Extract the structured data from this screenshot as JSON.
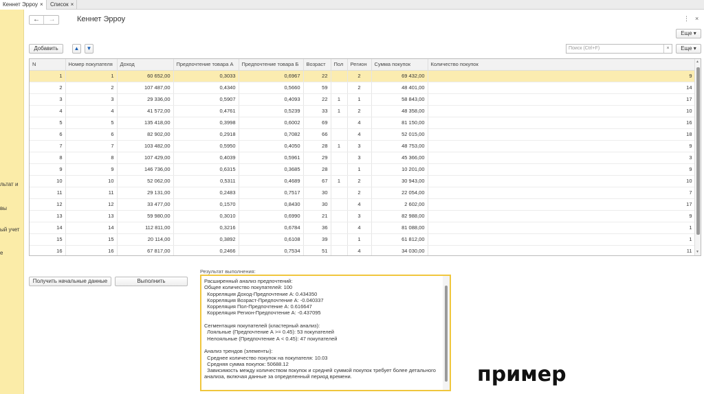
{
  "tabs": [
    {
      "label": "Кеннет Эрроу"
    },
    {
      "label": "Список"
    }
  ],
  "sidebar": {
    "items": [
      "льтат и",
      "вы",
      "ый учет",
      "е"
    ]
  },
  "header": {
    "title": "Кеннет Эрроу",
    "more_label": "Еще",
    "more_glyph": "⋮",
    "close_glyph": "×"
  },
  "toolbar": {
    "add_label": "Добавить",
    "search_placeholder": "Поиск (Ctrl+F)",
    "clear_glyph": "×",
    "more_label": "Еще"
  },
  "table": {
    "columns": [
      "N",
      "Номер покупателя",
      "Доход",
      "Предпочтение товара А",
      "Предпочтение товара Б",
      "Возраст",
      "Пол",
      "Регион",
      "Сумма покупок",
      "Количество покупок"
    ],
    "rows": [
      [
        "1",
        "1",
        "60 652,00",
        "0,3033",
        "0,6967",
        "22",
        "",
        "2",
        "69 432,00",
        "9"
      ],
      [
        "2",
        "2",
        "107 487,00",
        "0,4340",
        "0,5660",
        "59",
        "",
        "2",
        "48 401,00",
        "14"
      ],
      [
        "3",
        "3",
        "29 336,00",
        "0,5907",
        "0,4093",
        "22",
        "1",
        "1",
        "58 843,00",
        "17"
      ],
      [
        "4",
        "4",
        "41 572,00",
        "0,4761",
        "0,5239",
        "33",
        "1",
        "2",
        "48 358,00",
        "10"
      ],
      [
        "5",
        "5",
        "135 418,00",
        "0,3998",
        "0,6002",
        "69",
        "",
        "4",
        "81 150,00",
        "16"
      ],
      [
        "6",
        "6",
        "82 902,00",
        "0,2918",
        "0,7082",
        "66",
        "",
        "4",
        "52 015,00",
        "18"
      ],
      [
        "7",
        "7",
        "103 482,00",
        "0,5950",
        "0,4050",
        "28",
        "1",
        "3",
        "48 753,00",
        "9"
      ],
      [
        "8",
        "8",
        "107 429,00",
        "0,4039",
        "0,5961",
        "29",
        "",
        "3",
        "45 366,00",
        "3"
      ],
      [
        "9",
        "9",
        "146 736,00",
        "0,6315",
        "0,3685",
        "28",
        "",
        "1",
        "10 201,00",
        "9"
      ],
      [
        "10",
        "10",
        "52 062,00",
        "0,5311",
        "0,4689",
        "67",
        "1",
        "2",
        "30 943,00",
        "10"
      ],
      [
        "11",
        "11",
        "29 131,00",
        "0,2483",
        "0,7517",
        "30",
        "",
        "2",
        "22 054,00",
        "7"
      ],
      [
        "12",
        "12",
        "33 477,00",
        "0,1570",
        "0,8430",
        "30",
        "",
        "4",
        "2 602,00",
        "17"
      ],
      [
        "13",
        "13",
        "59 980,00",
        "0,3010",
        "0,6990",
        "21",
        "",
        "3",
        "82 988,00",
        "9"
      ],
      [
        "14",
        "14",
        "112 811,00",
        "0,3216",
        "0,6784",
        "36",
        "",
        "4",
        "81 088,00",
        "1"
      ],
      [
        "15",
        "15",
        "20 114,00",
        "0,3892",
        "0,6108",
        "39",
        "",
        "1",
        "61 812,00",
        "1"
      ],
      [
        "16",
        "16",
        "67 817,00",
        "0,2466",
        "0,7534",
        "51",
        "",
        "4",
        "34 030,00",
        "11"
      ]
    ]
  },
  "actions": {
    "get_data_label": "Получить начальные данные",
    "run_label": "Выполнить"
  },
  "result": {
    "label": "Результат выполнения:",
    "text": "Расширенный анализ предпочтений:\nОбщее количество покупателей: 100\n  Корреляция Доход-Предпочтение А: 0.434350\n  Корреляция Возраст-Предпочтение А: -0.040337\n  Корреляция Пол-Предпочтение А: 0.616647\n  Корреляция Регион-Предпочтение А: -0.437095\n\nСегментация покупателей (кластерный анализ):\n  Лояльные (Предпочтение А >= 0.45): 53 покупателей\n  Нелояльные (Предпочтение А < 0.45): 47 покупателей\n\nАнализ трендов (элементы):\n  Среднее количество покупок на покупателя: 10.03\n  Средняя сумма покупок: 50688.12\n  Зависимость между количеством покупок и средней суммой покупок требует более детального\nанализа, включая данные за определенный период времени."
  },
  "watermark": "пример",
  "colors": {
    "sidebar_bg": "#fbeca8",
    "selected_row": "#fbecb0",
    "result_border": "#f0c63c",
    "arrow_blue": "#1a5fb4"
  }
}
